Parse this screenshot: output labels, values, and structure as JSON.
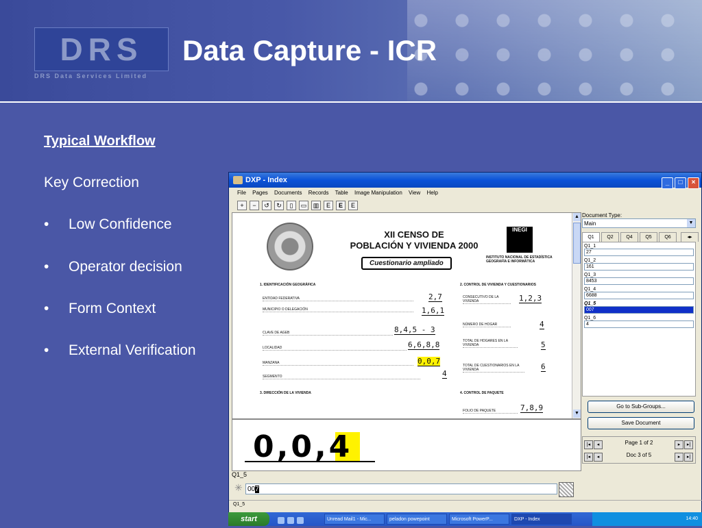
{
  "slide": {
    "logo_text": "DRS",
    "logo_sub": "DRS Data Services Limited",
    "title": "Data Capture - ICR",
    "heading": "Typical Workflow",
    "subheading": "Key Correction",
    "bullets": [
      "Low Confidence",
      "Operator decision",
      "Form Context",
      "External Verification"
    ],
    "bullet_glyph": "•"
  },
  "window": {
    "title": "DXP - Index",
    "menu": [
      "File",
      "Pages",
      "Documents",
      "Records",
      "Table",
      "Image Manipulation",
      "View",
      "Help"
    ],
    "toolbar_icons": [
      "zoom-in-icon",
      "zoom-out-icon",
      "rotate-left-icon",
      "rotate-right-icon",
      "page-icon",
      "single-page-icon",
      "double-page-icon",
      "e-icon",
      "e-bold-icon",
      "e-box-icon"
    ]
  },
  "form": {
    "title_line1": "XII CENSO DE",
    "title_line2": "POBLACIÓN Y VIVIENDA 2000",
    "subtitle": "Cuestionario ampliado",
    "logo": "INEGI",
    "institute": "INSTITUTO NACIONAL DE ESTADÍSTICA GEOGRAFÍA E INFORMÁTICA",
    "sec1": "1. IDENTIFICACIÓN GEOGRÁFICA",
    "sec2": "2. CONTROL DE VIVIENDA Y CUESTIONARIOS",
    "sec3": "3. DIRECCIÓN DE LA VIVIENDA",
    "sec4": "4. CONTROL DE PAQUETE",
    "left_rows": [
      {
        "label": "ENTIDAD FEDERATIVA",
        "value": "2,7"
      },
      {
        "label": "MUNICIPIO O DELEGACIÓN",
        "value": "1,6,1"
      },
      {
        "label": "CLAVE DE AGEB",
        "value": "8,4,5 - 3"
      },
      {
        "label": "LOCALIDAD",
        "value": "6,6,8,8"
      },
      {
        "label": "MANZANA",
        "value": "0,0,7"
      },
      {
        "label": "SEGMENTO",
        "value": "4"
      }
    ],
    "right_rows": [
      {
        "label": "CONSECUTIVO DE LA VIVIENDA",
        "value": "1,2,3"
      },
      {
        "label": "NÚMERO DE HOGAR",
        "value": "4"
      },
      {
        "label": "TOTAL DE HOGARES EN LA VIVIENDA",
        "value": "5"
      },
      {
        "label": "TOTAL DE CUESTIONARIOS EN LA VIVIENDA",
        "value": "6"
      },
      {
        "label": "FOLIO DE PAQUETE",
        "value": "7,8,9"
      }
    ]
  },
  "zoom": {
    "digits": "0,0,4"
  },
  "panel": {
    "doc_type_label": "Document Type:",
    "doc_type_value": "Main",
    "tabs": [
      "Q1",
      "Q2",
      "Q4",
      "Q5",
      "Q6"
    ],
    "fields": [
      {
        "name": "Q1_1",
        "value": "27"
      },
      {
        "name": "Q1_2",
        "value": "161"
      },
      {
        "name": "Q1_3",
        "value": "8453"
      },
      {
        "name": "Q1_4",
        "value": "6688"
      },
      {
        "name": "Q1_5",
        "value": "007"
      },
      {
        "name": "Q1_6",
        "value": "4"
      }
    ],
    "goto_label": "Go to Sub-Groups...",
    "save_label": "Save Document",
    "page_label": "Page 1 of 2",
    "doc_label": "Doc 3 of 5"
  },
  "entry": {
    "field_label": "Q1_5",
    "value_prefix": "00",
    "value_cursor": "7"
  },
  "status": {
    "text": "Q1_5"
  },
  "taskbar": {
    "start": "start",
    "tasks": [
      "Unread Mail1 - Mic...",
      "peladon powepoint",
      "Microsoft PowerP...",
      "DXP - Index"
    ],
    "clock": "14:40"
  }
}
